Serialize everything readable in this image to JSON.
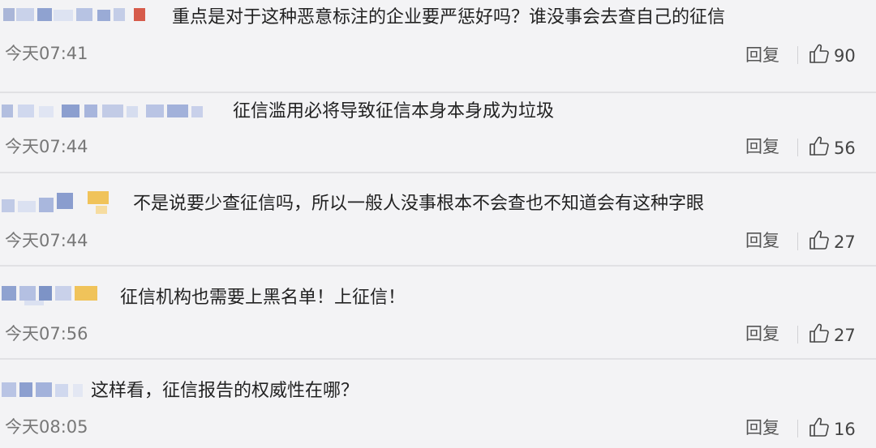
{
  "comments": [
    {
      "text": "重点是对于这种恶意标注的企业要严惩好吗？谁没事会去查自己的征信",
      "time": "今天07:41",
      "reply_label": "回复",
      "likes": "90"
    },
    {
      "text": "征信滥用必将导致征信本身本身成为垃圾",
      "time": "今天07:44",
      "reply_label": "回复",
      "likes": "56"
    },
    {
      "text": "不是说要少查征信吗，所以一般人没事根本不会查也不知道会有这种字眼",
      "time": "今天07:44",
      "reply_label": "回复",
      "likes": "27"
    },
    {
      "text": "征信机构也需要上黑名单！上征信！",
      "time": "今天07:56",
      "reply_label": "回复",
      "likes": "27"
    },
    {
      "text": "这样看，征信报告的权威性在哪？",
      "time": "今天08:05",
      "reply_label": "回复",
      "likes": "16"
    }
  ],
  "icons": {
    "like": "thumbs-up-icon"
  },
  "colors": {
    "background": "#f3f3f5",
    "divider": "#e1e1e4",
    "comment_text": "#222222",
    "meta_text": "#777777",
    "mosaic_blue": "#7d93c6",
    "mosaic_red": "#d65b4b",
    "mosaic_yellow": "#f0c35a"
  }
}
